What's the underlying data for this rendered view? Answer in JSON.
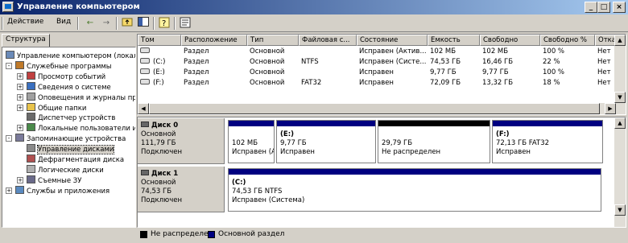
{
  "window": {
    "title": "Управление компьютером",
    "minimize": "_",
    "maximize": "□",
    "close": "×"
  },
  "menu": {
    "action": "Действие",
    "view": "Вид"
  },
  "tabs": {
    "structure": "Структура"
  },
  "tree": {
    "items": [
      {
        "label": "Управление компьютером (локаль",
        "level": 0,
        "expander": "",
        "icon": "computer-icon"
      },
      {
        "label": "Служебные программы",
        "level": 1,
        "expander": "-",
        "icon": "tools-icon"
      },
      {
        "label": "Просмотр событий",
        "level": 2,
        "expander": "+",
        "icon": "event-viewer-icon"
      },
      {
        "label": "Сведения о системе",
        "level": 2,
        "expander": "+",
        "icon": "system-info-icon"
      },
      {
        "label": "Оповещения и журналы про",
        "level": 2,
        "expander": "+",
        "icon": "alerts-logs-icon"
      },
      {
        "label": "Общие папки",
        "level": 2,
        "expander": "+",
        "icon": "shared-folders-icon"
      },
      {
        "label": "Диспетчер устройств",
        "level": 2,
        "expander": "",
        "icon": "device-manager-icon"
      },
      {
        "label": "Локальные пользователи и",
        "level": 2,
        "expander": "+",
        "icon": "local-users-icon"
      },
      {
        "label": "Запоминающие устройства",
        "level": 1,
        "expander": "-",
        "icon": "storage-icon"
      },
      {
        "label": "Управление дисками",
        "level": 2,
        "expander": "",
        "icon": "disk-management-icon",
        "selected": true
      },
      {
        "label": "Дефрагментация диска",
        "level": 2,
        "expander": "",
        "icon": "defrag-icon"
      },
      {
        "label": "Логические диски",
        "level": 2,
        "expander": "",
        "icon": "logical-drives-icon"
      },
      {
        "label": "Съемные ЗУ",
        "level": 2,
        "expander": "+",
        "icon": "removable-storage-icon"
      },
      {
        "label": "Службы и приложения",
        "level": 1,
        "expander": "+",
        "icon": "services-apps-icon"
      }
    ]
  },
  "volumes": {
    "columns": [
      "Том",
      "Расположение",
      "Тип",
      "Файловая с...",
      "Состояние",
      "Емкость",
      "Свободно",
      "Свободно %",
      "Отказоу"
    ],
    "rows": [
      [
        "",
        "Раздел",
        "Основной",
        "",
        "Исправен (Актив...",
        "102 МБ",
        "102 МБ",
        "100 %",
        "Нет"
      ],
      [
        "(C:)",
        "Раздел",
        "Основной",
        "NTFS",
        "Исправен (Систе...",
        "74,53 ГБ",
        "16,46 ГБ",
        "22 %",
        "Нет"
      ],
      [
        "(E:)",
        "Раздел",
        "Основной",
        "",
        "Исправен",
        "9,77 ГБ",
        "9,77 ГБ",
        "100 %",
        "Нет"
      ],
      [
        "(F:)",
        "Раздел",
        "Основной",
        "FAT32",
        "Исправен",
        "72,09 ГБ",
        "13,32 ГБ",
        "18 %",
        "Нет"
      ]
    ]
  },
  "disks": [
    {
      "name": "Диск 0",
      "type": "Основной",
      "size": "111,79 ГБ",
      "status": "Подключен",
      "partitions": [
        {
          "name": "",
          "size": "102 МБ",
          "state": "Исправен (А",
          "kind": "primary"
        },
        {
          "name": "(E:)",
          "size": "9,77 ГБ",
          "state": "Исправен",
          "kind": "primary"
        },
        {
          "name": "",
          "size": "29,79 ГБ",
          "state": "Не распределен",
          "kind": "unallocated"
        },
        {
          "name": "(F:)",
          "size": "72,13 ГБ FAT32",
          "state": "Исправен",
          "kind": "primary"
        }
      ]
    },
    {
      "name": "Диск 1",
      "type": "Основной",
      "size": "74,53 ГБ",
      "status": "Подключен",
      "partitions": [
        {
          "name": "(C:)",
          "size": "74,53 ГБ NTFS",
          "state": "Исправен (Система)",
          "kind": "primary"
        }
      ]
    }
  ],
  "legend": {
    "unallocated": "Не распределен",
    "primary": "Основной раздел"
  },
  "colors": {
    "primary_bar": "#000080",
    "unallocated_bar": "#000000",
    "title_start": "#0a246a",
    "title_end": "#a6caf0"
  }
}
